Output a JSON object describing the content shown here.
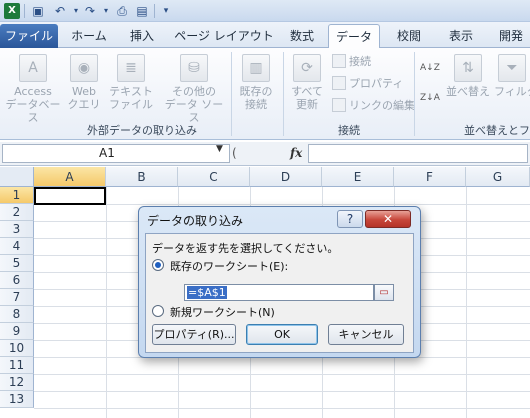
{
  "qat": {
    "icons": [
      "save-icon",
      "undo-icon",
      "redo-icon",
      "print-preview-icon",
      "new-document-icon",
      "customize-qat-icon"
    ]
  },
  "tabs": {
    "file": "ファイル",
    "home": "ホーム",
    "insert": "挿入",
    "page_layout": "ページ レイアウト",
    "formulas": "数式",
    "data": "データ",
    "review": "校閲",
    "view": "表示",
    "developer": "開発"
  },
  "ribbon": {
    "access_line1": "Access",
    "access_line2": "データベース",
    "web_line1": "Web",
    "web_line2": "クエリ",
    "text_line1": "テキスト",
    "text_line2": "ファイル",
    "other_line1": "その他の",
    "other_line2": "データ ソース",
    "existing_line1": "既存の",
    "existing_line2": "接続",
    "group_external": "外部データの取り込み",
    "refresh_line1": "すべて",
    "refresh_line2": "更新",
    "connections": "接続",
    "properties": "プロパティ",
    "edit_links": "リンクの編集",
    "group_connections": "接続",
    "sort_az": "A↓Z",
    "sort_za": "Z↓A",
    "sort": "並べ替え",
    "filter": "フィルター",
    "group_sort": "並べ替えとフ"
  },
  "formula_bar": {
    "name_box": "A1",
    "fx": "fx",
    "formula": ""
  },
  "grid": {
    "columns": [
      "A",
      "B",
      "C",
      "D",
      "E",
      "F",
      "G"
    ],
    "rows": [
      "1",
      "2",
      "3",
      "4",
      "5",
      "6",
      "7",
      "8",
      "9",
      "10",
      "11",
      "12",
      "13"
    ],
    "active_cell": "A1"
  },
  "dialog": {
    "title": "データの取り込み",
    "help": "?",
    "close": "✕",
    "prompt": "データを返す先を選択してください。",
    "option_existing": "既存のワークシート(E):",
    "reference": "=$A$1",
    "option_new": "新規ワークシート(N)",
    "properties_button": "プロパティ(R)...",
    "ok_button": "OK",
    "cancel_button": "キャンセル"
  }
}
